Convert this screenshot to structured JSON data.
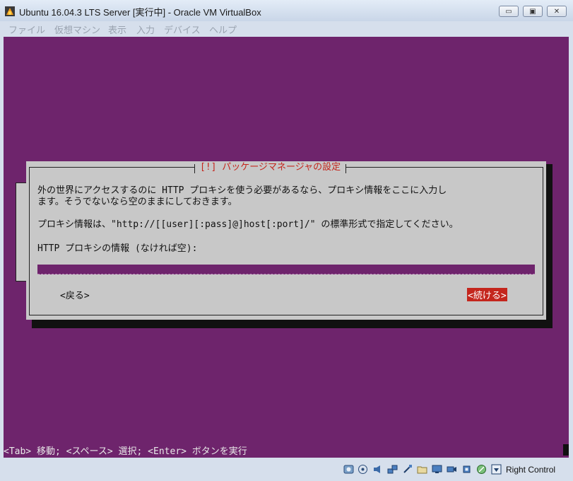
{
  "window": {
    "title": "Ubuntu 16.04.3 LTS Server [実行中] - Oracle VM VirtualBox",
    "min_glyph": "▭",
    "max_glyph": "▣",
    "close_glyph": "✕"
  },
  "menubar": {
    "items": [
      "ファイル",
      "仮想マシン",
      "表示",
      "入力",
      "デバイス",
      "ヘルプ"
    ]
  },
  "dialog": {
    "title": "[!] パッケージマネージャの設定",
    "line1": "外の世界にアクセスするのに HTTP プロキシを使う必要があるなら、プロキシ情報をここに入力し",
    "line2": "ます。そうでないなら空のままにしておきます。",
    "line3": "プロキシ情報は、\"http://[[user][:pass]@]host[:port]/\" の標準形式で指定してください。",
    "input_label": "HTTP プロキシの情報 (なければ空):",
    "input_value": "",
    "back_button": "<戻る>",
    "continue_button": "<続ける>"
  },
  "help_line": "<Tab> 移動; <スペース> 選択; <Enter> ボタンを実行",
  "statusbar": {
    "host_key": "Right Control",
    "icons": [
      "hard-disk-icon",
      "optical-drive-icon",
      "audio-icon",
      "network-icon",
      "usb-icon",
      "shared-folders-icon",
      "display-icon",
      "video-capture-icon",
      "cpu-icon",
      "mouse-integration-icon",
      "keyboard-icon"
    ]
  },
  "colors": {
    "console_bg": "#6e246c",
    "dialog_bg": "#c8c8c8",
    "accent_red": "#c4261d"
  }
}
